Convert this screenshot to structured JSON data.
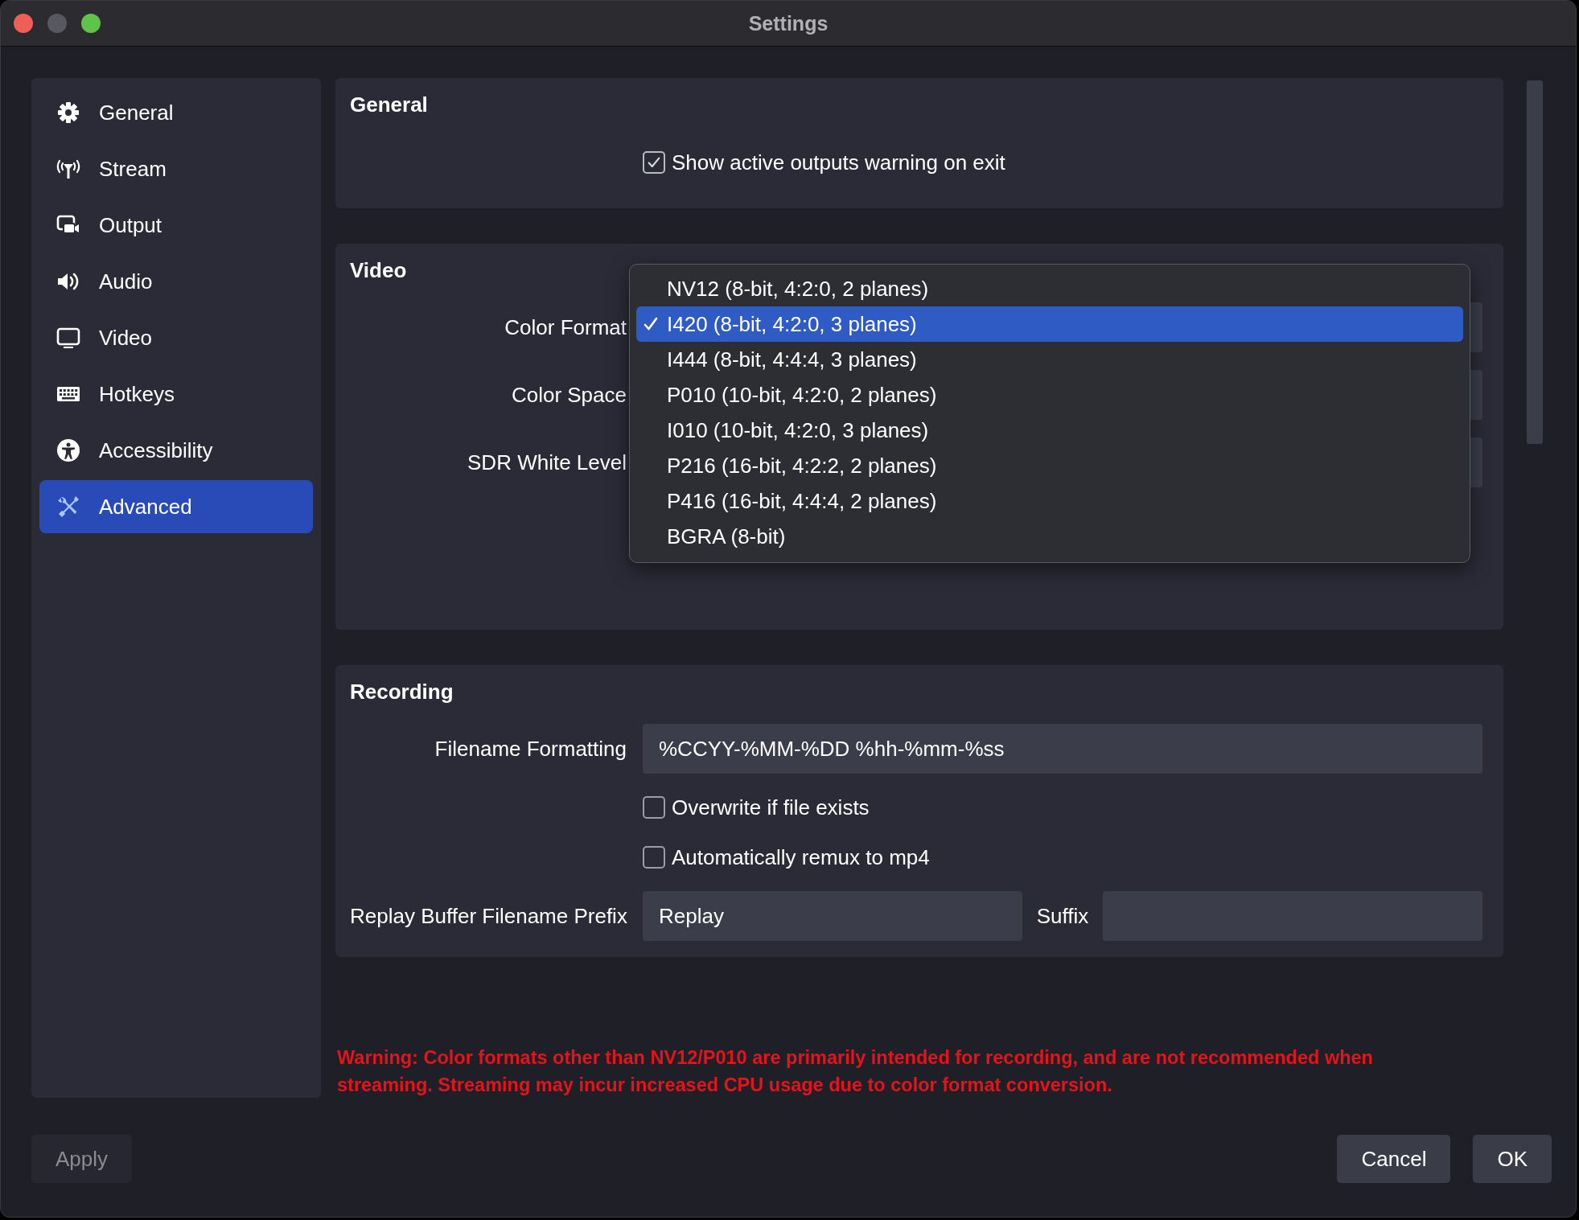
{
  "window": {
    "title": "Settings"
  },
  "sidebar": {
    "items": [
      {
        "label": "General",
        "selected": false
      },
      {
        "label": "Stream",
        "selected": false
      },
      {
        "label": "Output",
        "selected": false
      },
      {
        "label": "Audio",
        "selected": false
      },
      {
        "label": "Video",
        "selected": false
      },
      {
        "label": "Hotkeys",
        "selected": false
      },
      {
        "label": "Accessibility",
        "selected": false
      },
      {
        "label": "Advanced",
        "selected": true
      }
    ]
  },
  "sections": [
    {
      "kind": "general",
      "title": "General",
      "rows": [
        {
          "kind": "checkbox",
          "label": "Show active outputs warning on exit",
          "checked": true
        }
      ]
    },
    {
      "kind": "video",
      "title": "Video",
      "rows": [
        {
          "kind": "combo",
          "label": "Color Format",
          "open": true,
          "options": [
            {
              "label": "NV12 (8-bit, 4:2:0, 2 planes)",
              "selected": false
            },
            {
              "label": "I420 (8-bit, 4:2:0, 3 planes)",
              "selected": true
            },
            {
              "label": "I444 (8-bit, 4:4:4, 3 planes)",
              "selected": false
            },
            {
              "label": "P010 (10-bit, 4:2:0, 2 planes)",
              "selected": false
            },
            {
              "label": "I010 (10-bit, 4:2:0, 3 planes)",
              "selected": false
            },
            {
              "label": "P216 (16-bit, 4:2:2, 2 planes)",
              "selected": false
            },
            {
              "label": "P416 (16-bit, 4:4:4, 2 planes)",
              "selected": false
            },
            {
              "label": "BGRA (8-bit)",
              "selected": false
            }
          ]
        },
        {
          "kind": "combo",
          "label": "Color Space",
          "open": false
        },
        {
          "kind": "combo",
          "label": "SDR White Level",
          "open": false
        }
      ]
    },
    {
      "kind": "recording",
      "title": "Recording",
      "rows": [
        {
          "kind": "text",
          "label": "Filename Formatting",
          "value": "%CCYY-%MM-%DD %hh-%mm-%ss"
        },
        {
          "kind": "checkbox",
          "label": "Overwrite if file exists",
          "checked": false
        },
        {
          "kind": "checkbox",
          "label": "Automatically remux to mp4",
          "checked": false
        },
        {
          "kind": "text_pair",
          "label": "Replay Buffer Filename Prefix",
          "value": "Replay",
          "second_label": "Suffix"
        }
      ]
    }
  ],
  "warning": "Warning: Color formats other than NV12/P010 are primarily intended for recording, and are not recommended when streaming. Streaming may incur increased CPU usage due to color format conversion.",
  "buttons": [
    {
      "label": "Apply",
      "disabled": true
    },
    {
      "label": "Cancel",
      "disabled": false
    },
    {
      "label": "OK",
      "disabled": false
    }
  ]
}
